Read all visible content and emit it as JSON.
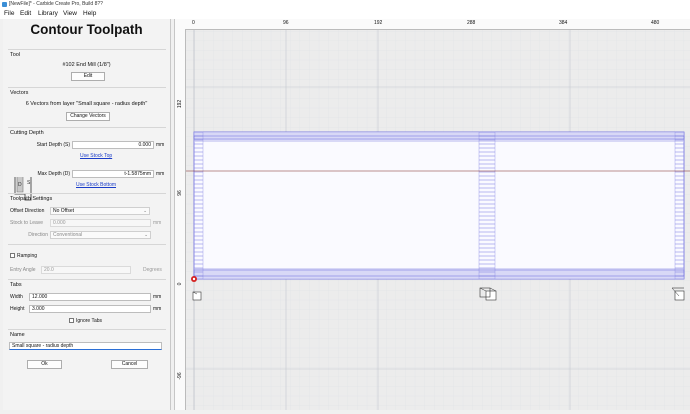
{
  "window": {
    "title": "[NewFile]* - Carbide Create Pro, Build 8??"
  },
  "menu": {
    "file": "File",
    "edit": "Edit",
    "library": "Library",
    "view": "View",
    "help": "Help"
  },
  "panel": {
    "title": "Contour Toolpath",
    "tool": {
      "label": "Tool",
      "name": "#102 End Mill (1/8\")",
      "edit_button": "Edit"
    },
    "vectors": {
      "label": "Vectors",
      "description": "6 Vectors from layer \"Small square - radius depth\"",
      "change_button": "Change Vectors"
    },
    "cutting_depth": {
      "label": "Cutting Depth",
      "start_label": "Start Depth (S)",
      "start_value": "0.000",
      "start_unit": "mm",
      "use_stock_top": "Use Stock Top",
      "max_label": "Max Depth (D)",
      "max_value": "t-1.5875mm",
      "max_unit": "mm",
      "use_stock_bottom": "Use Stock Bottom"
    },
    "toolpath_settings": {
      "label": "Toolpath Settings",
      "offset_label": "Offset Direction",
      "offset_value": "No Offset",
      "stock_label": "Stock to Leave",
      "stock_value": "0.000",
      "stock_unit": "mm",
      "direction_label": "Direction",
      "direction_value": "Conventional"
    },
    "ramping": {
      "label": "Ramping",
      "entry_label": "Entry Angle",
      "entry_value": "20.0",
      "entry_unit": "Degrees"
    },
    "tabs": {
      "label": "Tabs",
      "width_label": "Width",
      "width_value": "12.000",
      "width_unit": "mm",
      "height_label": "Height",
      "height_value": "3.000",
      "height_unit": "mm",
      "ignore_label": "Ignore Tabs"
    },
    "name": {
      "label": "Name",
      "value": "Small square - radius depth"
    },
    "ok_button": "Ok",
    "cancel_button": "Cancel"
  },
  "canvas": {
    "ruler_x_labels": [
      "0",
      "96",
      "192",
      "288",
      "384",
      "480"
    ],
    "ruler_y_labels": [
      "192",
      "96",
      "0",
      "-96"
    ],
    "colors": {
      "stock": "#c9c9f2",
      "grid": "#d9dce4",
      "vector": "#6a6adc",
      "origin": "#d42020"
    }
  }
}
